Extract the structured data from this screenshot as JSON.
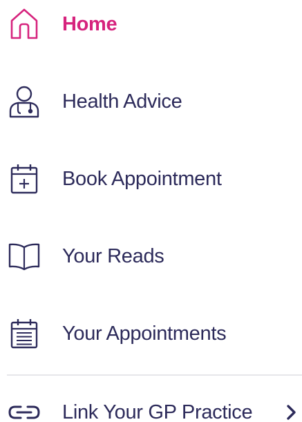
{
  "colors": {
    "accent": "#d6237d",
    "text": "#2c2a5a",
    "divider": "#e6e6ea"
  },
  "menu": {
    "items": [
      {
        "label": "Home",
        "icon": "home-icon",
        "active": true
      },
      {
        "label": "Health Advice",
        "icon": "doctor-icon",
        "active": false
      },
      {
        "label": "Book Appointment",
        "icon": "calendar-add-icon",
        "active": false
      },
      {
        "label": "Your Reads",
        "icon": "book-icon",
        "active": false
      },
      {
        "label": "Your Appointments",
        "icon": "calendar-list-icon",
        "active": false
      }
    ],
    "link_gp": {
      "label": "Link Your GP Practice",
      "icon": "link-icon",
      "trailing_icon": "chevron-right-icon"
    }
  }
}
